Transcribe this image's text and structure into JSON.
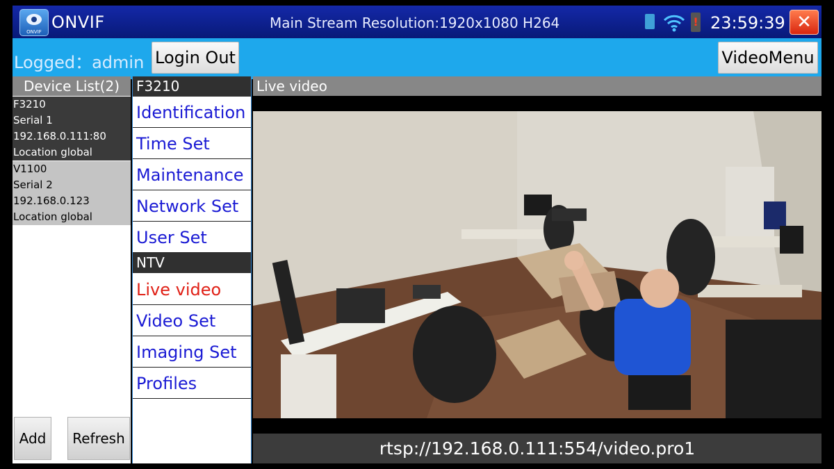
{
  "title_bar": {
    "app_name": "ONVIF",
    "logo_text": "ONVIF",
    "stream_info": "Main Stream Resolution:1920x1080 H264",
    "clock": "23:59:39",
    "battery_alert": "!",
    "close_label": "✕"
  },
  "toolbar": {
    "logged_text": "Logged：admin",
    "login_out_label": "Login Out",
    "video_menu_label": "VideoMenu"
  },
  "device_list": {
    "header": "Device List(2)",
    "devices": [
      {
        "name": "F3210",
        "serial": "Serial 1",
        "address": "192.168.0.111:80",
        "location": "Location global",
        "selected": true
      },
      {
        "name": "V1100",
        "serial": "Serial 2",
        "address": "192.168.0.123",
        "location": "Location global",
        "selected": false
      }
    ],
    "add_label": "Add",
    "refresh_label": "Refresh"
  },
  "menu": {
    "device_header": "F3210",
    "device_items": [
      "Identification",
      "Time Set",
      "Maintenance",
      "Network Set",
      "User Set"
    ],
    "ntv_header": "NTV",
    "ntv_items": [
      "Live video",
      "Video Set",
      "Imaging Set",
      "Profiles"
    ],
    "active_item": "Live video"
  },
  "video": {
    "header": "Live video",
    "rtsp_url": "rtsp://192.168.0.111:554/video.pro1"
  },
  "colors": {
    "title_bar": "#0a1f8c",
    "toolbar": "#1ea8ec",
    "menu_text": "#1a1ad4",
    "active_text": "#e02016",
    "selected_device": "#3a3a3a"
  }
}
